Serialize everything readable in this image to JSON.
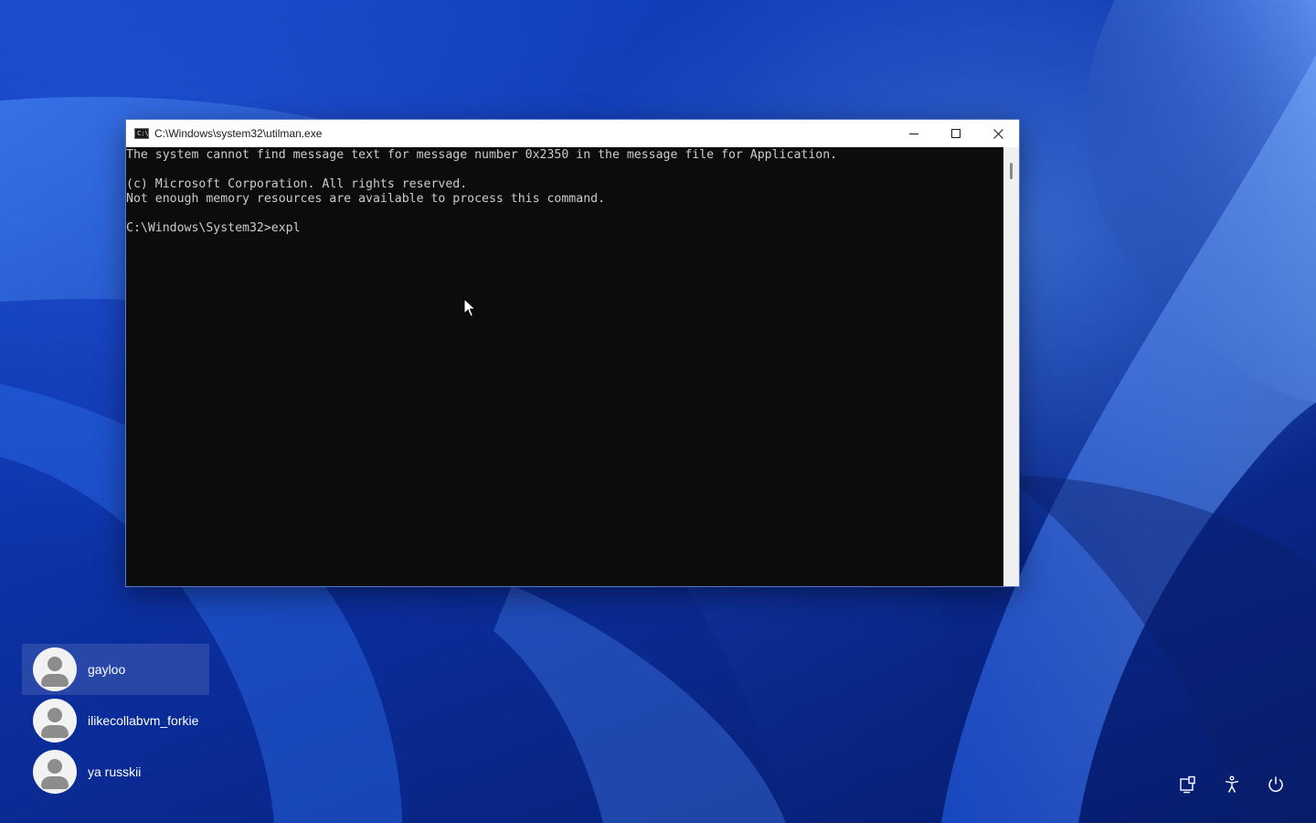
{
  "window": {
    "title": "C:\\Windows\\system32\\utilman.exe",
    "icon_label": "C:\\",
    "controls": [
      "minimize-icon",
      "maximize-icon",
      "close-icon"
    ]
  },
  "console": {
    "lines": [
      "The system cannot find message text for message number 0x2350 in the message file for Application.",
      "",
      "(c) Microsoft Corporation. All rights reserved.",
      "Not enough memory resources are available to process this command.",
      "",
      "C:\\Windows\\System32>expl"
    ]
  },
  "users": [
    {
      "name": "gayloo",
      "selected": true
    },
    {
      "name": "ilikecollabvm_forkie",
      "selected": false
    },
    {
      "name": "ya russkii",
      "selected": false
    }
  ],
  "system_buttons": [
    "network-icon",
    "accessibility-icon",
    "power-icon"
  ]
}
